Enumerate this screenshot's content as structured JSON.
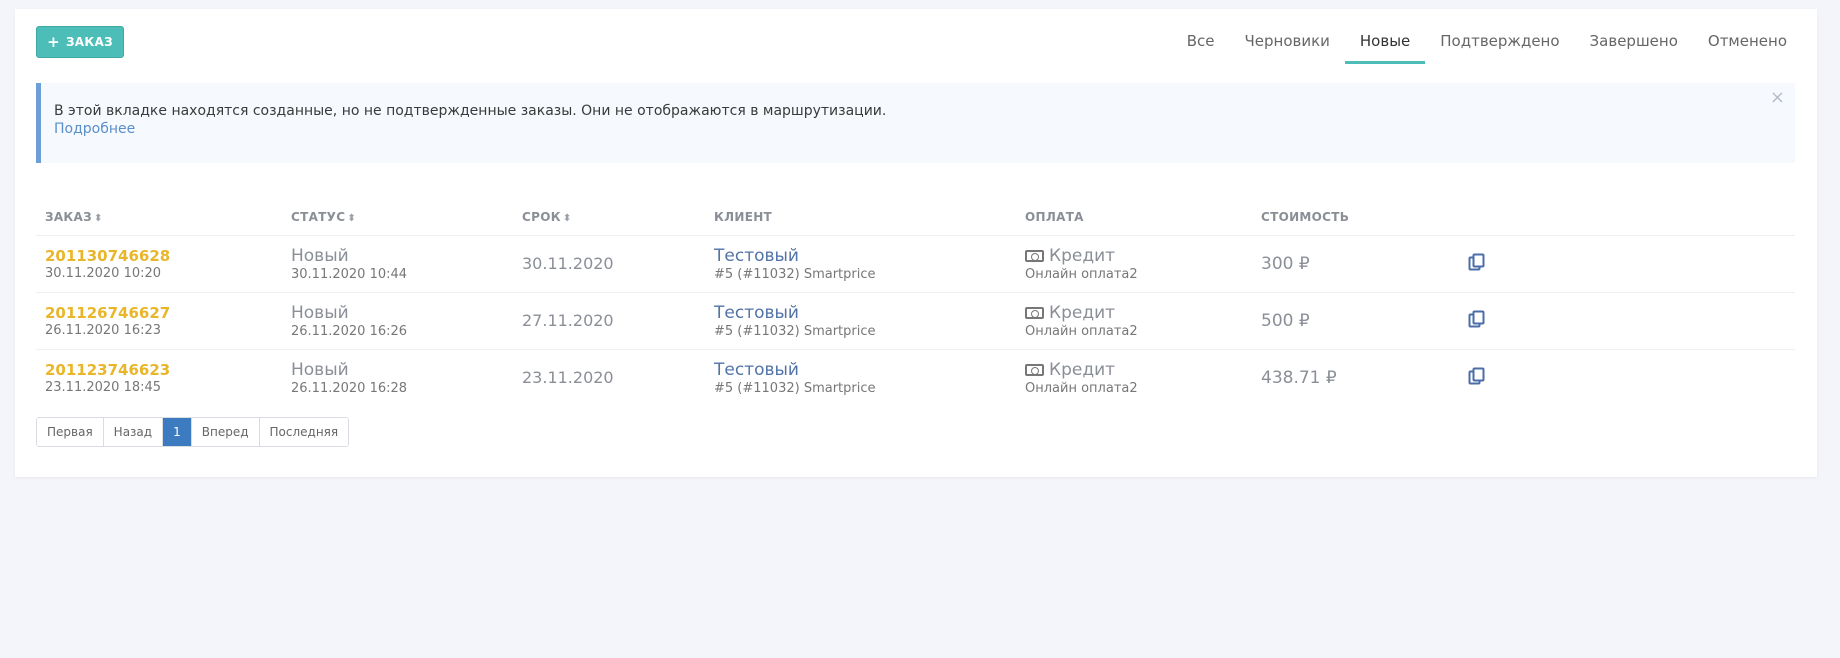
{
  "toolbar": {
    "add_label": "ЗАКАЗ",
    "add_icon": "plus-icon"
  },
  "tabs": [
    {
      "label": "Все",
      "active": false
    },
    {
      "label": "Черновики",
      "active": false
    },
    {
      "label": "Новые",
      "active": true
    },
    {
      "label": "Подтверждено",
      "active": false
    },
    {
      "label": "Завершено",
      "active": false
    },
    {
      "label": "Отменено",
      "active": false
    }
  ],
  "alert": {
    "text": "В этой вкладке находятся созданные, но не подтвержденные заказы. Они не отображаются в маршрутизации.",
    "more": "Подробнее",
    "close": "×"
  },
  "table": {
    "headers": {
      "order": "ЗАКАЗ",
      "status": "СТАТУС",
      "deadline": "СРОК",
      "client": "КЛИЕНТ",
      "payment": "ОПЛАТА",
      "cost": "СТОИМОСТЬ"
    },
    "rows": [
      {
        "order": "201130746628",
        "order_date": "30.11.2020 10:20",
        "status": "Новый",
        "status_date": "30.11.2020 10:44",
        "deadline": "30.11.2020",
        "client": "Тестовый",
        "client_sub": "#5 (#11032) Smartprice",
        "payment": "Кредит",
        "payment_sub": "Онлайн оплата2",
        "cost": "300 ₽"
      },
      {
        "order": "201126746627",
        "order_date": "26.11.2020 16:23",
        "status": "Новый",
        "status_date": "26.11.2020 16:26",
        "deadline": "27.11.2020",
        "client": "Тестовый",
        "client_sub": "#5 (#11032) Smartprice",
        "payment": "Кредит",
        "payment_sub": "Онлайн оплата2",
        "cost": "500 ₽"
      },
      {
        "order": "201123746623",
        "order_date": "23.11.2020 18:45",
        "status": "Новый",
        "status_date": "26.11.2020 16:28",
        "deadline": "23.11.2020",
        "client": "Тестовый",
        "client_sub": "#5 (#11032) Smartprice",
        "payment": "Кредит",
        "payment_sub": "Онлайн оплата2",
        "cost": "438.71 ₽"
      }
    ]
  },
  "pagination": {
    "first": "Первая",
    "prev": "Назад",
    "current": "1",
    "next": "Вперед",
    "last": "Последняя"
  },
  "colors": {
    "accent": "#4dbdb7",
    "order_number": "#e9b62a",
    "link": "#5173a6",
    "pager_active": "#3d7bc0",
    "alert_border": "#6d9fd6"
  }
}
